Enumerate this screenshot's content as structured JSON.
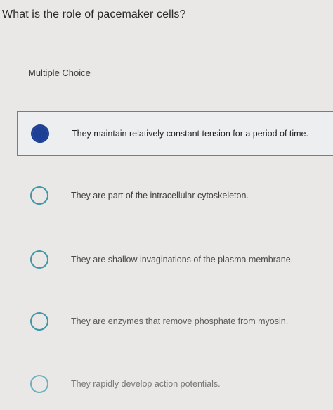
{
  "question": "What is the role of pacemaker cells?",
  "section_label": "Multiple Choice",
  "options": [
    {
      "text": "They maintain relatively constant tension for a period of time.",
      "selected": true
    },
    {
      "text": "They are part of the intracellular cytoskeleton.",
      "selected": false
    },
    {
      "text": "They are shallow invaginations of the plasma membrane.",
      "selected": false
    },
    {
      "text": "They are enzymes that remove phosphate from myosin.",
      "selected": false
    },
    {
      "text": "They rapidly develop action potentials.",
      "selected": false
    }
  ],
  "colors": {
    "selected_radio": "#1d3f94",
    "radio_outline": "#3f97a8",
    "selected_border": "#6d7e95",
    "background": "#e9e8e6"
  }
}
